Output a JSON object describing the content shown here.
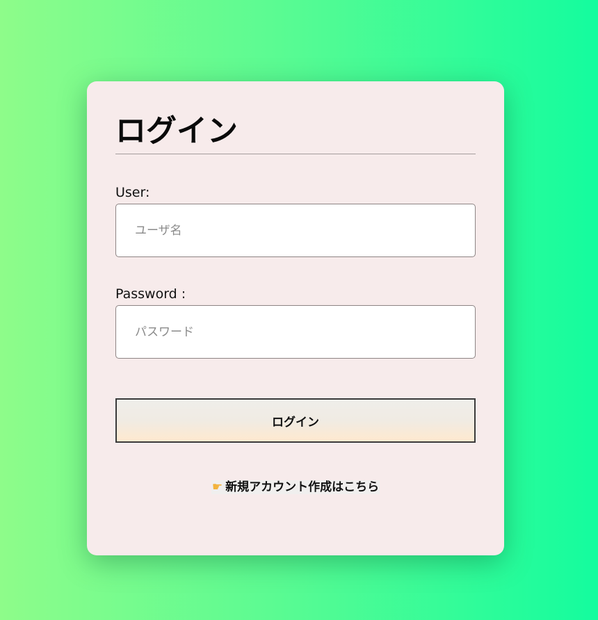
{
  "login_card": {
    "title": "ログイン",
    "user_label": "User:",
    "user_placeholder": "ユーザ名",
    "password_label": "Password :",
    "password_placeholder": "パスワード",
    "login_button": "ログイン",
    "register_link": "新規アカウント作成はこちら",
    "register_icon": "pointing-hand-icon"
  },
  "colors": {
    "background_start": "#8efc8a",
    "background_end": "#14fc9e",
    "card": "#f7ebeb",
    "button_bottom": "#ffe9cf"
  }
}
